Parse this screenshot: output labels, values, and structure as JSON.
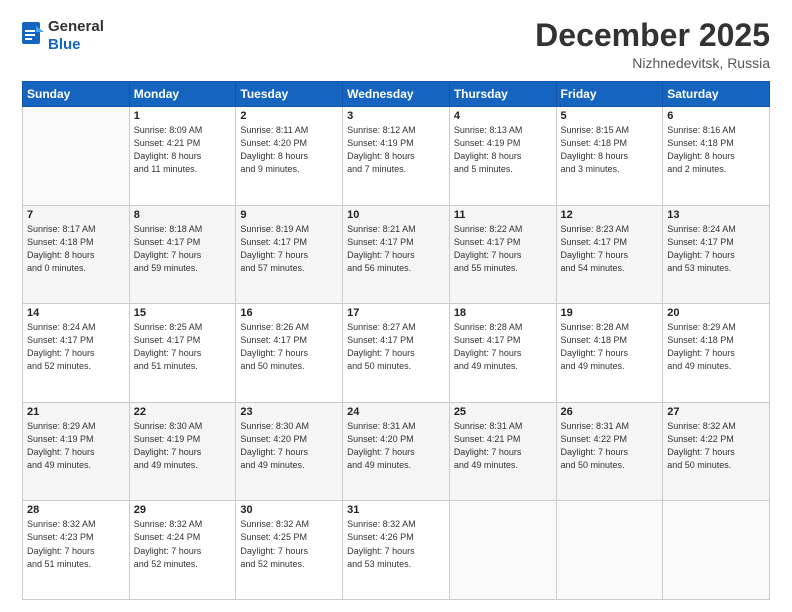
{
  "header": {
    "logo_line1": "General",
    "logo_line2": "Blue",
    "month_title": "December 2025",
    "location": "Nizhnedevitsk, Russia"
  },
  "weekdays": [
    "Sunday",
    "Monday",
    "Tuesday",
    "Wednesday",
    "Thursday",
    "Friday",
    "Saturday"
  ],
  "weeks": [
    [
      {
        "day": "",
        "info": ""
      },
      {
        "day": "1",
        "info": "Sunrise: 8:09 AM\nSunset: 4:21 PM\nDaylight: 8 hours\nand 11 minutes."
      },
      {
        "day": "2",
        "info": "Sunrise: 8:11 AM\nSunset: 4:20 PM\nDaylight: 8 hours\nand 9 minutes."
      },
      {
        "day": "3",
        "info": "Sunrise: 8:12 AM\nSunset: 4:19 PM\nDaylight: 8 hours\nand 7 minutes."
      },
      {
        "day": "4",
        "info": "Sunrise: 8:13 AM\nSunset: 4:19 PM\nDaylight: 8 hours\nand 5 minutes."
      },
      {
        "day": "5",
        "info": "Sunrise: 8:15 AM\nSunset: 4:18 PM\nDaylight: 8 hours\nand 3 minutes."
      },
      {
        "day": "6",
        "info": "Sunrise: 8:16 AM\nSunset: 4:18 PM\nDaylight: 8 hours\nand 2 minutes."
      }
    ],
    [
      {
        "day": "7",
        "info": "Sunrise: 8:17 AM\nSunset: 4:18 PM\nDaylight: 8 hours\nand 0 minutes."
      },
      {
        "day": "8",
        "info": "Sunrise: 8:18 AM\nSunset: 4:17 PM\nDaylight: 7 hours\nand 59 minutes."
      },
      {
        "day": "9",
        "info": "Sunrise: 8:19 AM\nSunset: 4:17 PM\nDaylight: 7 hours\nand 57 minutes."
      },
      {
        "day": "10",
        "info": "Sunrise: 8:21 AM\nSunset: 4:17 PM\nDaylight: 7 hours\nand 56 minutes."
      },
      {
        "day": "11",
        "info": "Sunrise: 8:22 AM\nSunset: 4:17 PM\nDaylight: 7 hours\nand 55 minutes."
      },
      {
        "day": "12",
        "info": "Sunrise: 8:23 AM\nSunset: 4:17 PM\nDaylight: 7 hours\nand 54 minutes."
      },
      {
        "day": "13",
        "info": "Sunrise: 8:24 AM\nSunset: 4:17 PM\nDaylight: 7 hours\nand 53 minutes."
      }
    ],
    [
      {
        "day": "14",
        "info": "Sunrise: 8:24 AM\nSunset: 4:17 PM\nDaylight: 7 hours\nand 52 minutes."
      },
      {
        "day": "15",
        "info": "Sunrise: 8:25 AM\nSunset: 4:17 PM\nDaylight: 7 hours\nand 51 minutes."
      },
      {
        "day": "16",
        "info": "Sunrise: 8:26 AM\nSunset: 4:17 PM\nDaylight: 7 hours\nand 50 minutes."
      },
      {
        "day": "17",
        "info": "Sunrise: 8:27 AM\nSunset: 4:17 PM\nDaylight: 7 hours\nand 50 minutes."
      },
      {
        "day": "18",
        "info": "Sunrise: 8:28 AM\nSunset: 4:17 PM\nDaylight: 7 hours\nand 49 minutes."
      },
      {
        "day": "19",
        "info": "Sunrise: 8:28 AM\nSunset: 4:18 PM\nDaylight: 7 hours\nand 49 minutes."
      },
      {
        "day": "20",
        "info": "Sunrise: 8:29 AM\nSunset: 4:18 PM\nDaylight: 7 hours\nand 49 minutes."
      }
    ],
    [
      {
        "day": "21",
        "info": "Sunrise: 8:29 AM\nSunset: 4:19 PM\nDaylight: 7 hours\nand 49 minutes."
      },
      {
        "day": "22",
        "info": "Sunrise: 8:30 AM\nSunset: 4:19 PM\nDaylight: 7 hours\nand 49 minutes."
      },
      {
        "day": "23",
        "info": "Sunrise: 8:30 AM\nSunset: 4:20 PM\nDaylight: 7 hours\nand 49 minutes."
      },
      {
        "day": "24",
        "info": "Sunrise: 8:31 AM\nSunset: 4:20 PM\nDaylight: 7 hours\nand 49 minutes."
      },
      {
        "day": "25",
        "info": "Sunrise: 8:31 AM\nSunset: 4:21 PM\nDaylight: 7 hours\nand 49 minutes."
      },
      {
        "day": "26",
        "info": "Sunrise: 8:31 AM\nSunset: 4:22 PM\nDaylight: 7 hours\nand 50 minutes."
      },
      {
        "day": "27",
        "info": "Sunrise: 8:32 AM\nSunset: 4:22 PM\nDaylight: 7 hours\nand 50 minutes."
      }
    ],
    [
      {
        "day": "28",
        "info": "Sunrise: 8:32 AM\nSunset: 4:23 PM\nDaylight: 7 hours\nand 51 minutes."
      },
      {
        "day": "29",
        "info": "Sunrise: 8:32 AM\nSunset: 4:24 PM\nDaylight: 7 hours\nand 52 minutes."
      },
      {
        "day": "30",
        "info": "Sunrise: 8:32 AM\nSunset: 4:25 PM\nDaylight: 7 hours\nand 52 minutes."
      },
      {
        "day": "31",
        "info": "Sunrise: 8:32 AM\nSunset: 4:26 PM\nDaylight: 7 hours\nand 53 minutes."
      },
      {
        "day": "",
        "info": ""
      },
      {
        "day": "",
        "info": ""
      },
      {
        "day": "",
        "info": ""
      }
    ]
  ]
}
